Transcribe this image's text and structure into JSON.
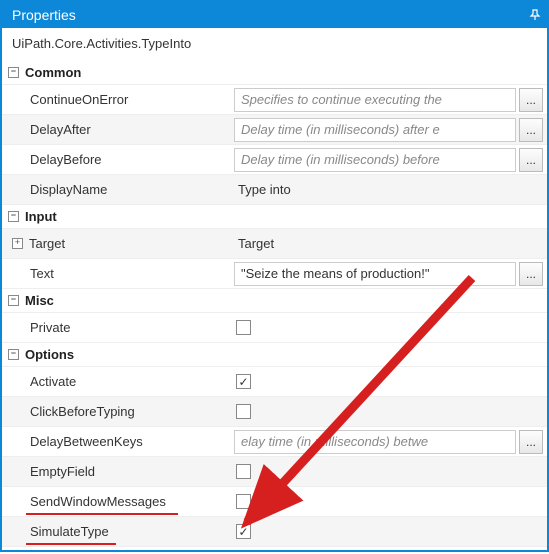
{
  "titlebar": {
    "title": "Properties"
  },
  "activity": {
    "fullName": "UiPath.Core.Activities.TypeInto"
  },
  "sections": {
    "common": {
      "header": "Common",
      "continueOnError": {
        "label": "ContinueOnError",
        "placeholder": "Specifies to continue executing the"
      },
      "delayAfter": {
        "label": "DelayAfter",
        "placeholder": "Delay time (in milliseconds) after e"
      },
      "delayBefore": {
        "label": "DelayBefore",
        "placeholder": "Delay time (in milliseconds) before"
      },
      "displayName": {
        "label": "DisplayName",
        "value": "Type into"
      }
    },
    "input": {
      "header": "Input",
      "target": {
        "label": "Target",
        "value": "Target"
      },
      "text": {
        "label": "Text",
        "value": "\"Seize the means of production!\""
      }
    },
    "misc": {
      "header": "Misc",
      "private": {
        "label": "Private"
      }
    },
    "options": {
      "header": "Options",
      "activate": {
        "label": "Activate"
      },
      "clickBeforeTyping": {
        "label": "ClickBeforeTyping"
      },
      "delayBetweenKeys": {
        "label": "DelayBetweenKeys",
        "placeholder": "elay time (in milliseconds) betwe"
      },
      "emptyField": {
        "label": "EmptyField"
      },
      "sendWindowMessages": {
        "label": "SendWindowMessages"
      },
      "simulateType": {
        "label": "SimulateType"
      }
    }
  },
  "ellipsis": "..."
}
